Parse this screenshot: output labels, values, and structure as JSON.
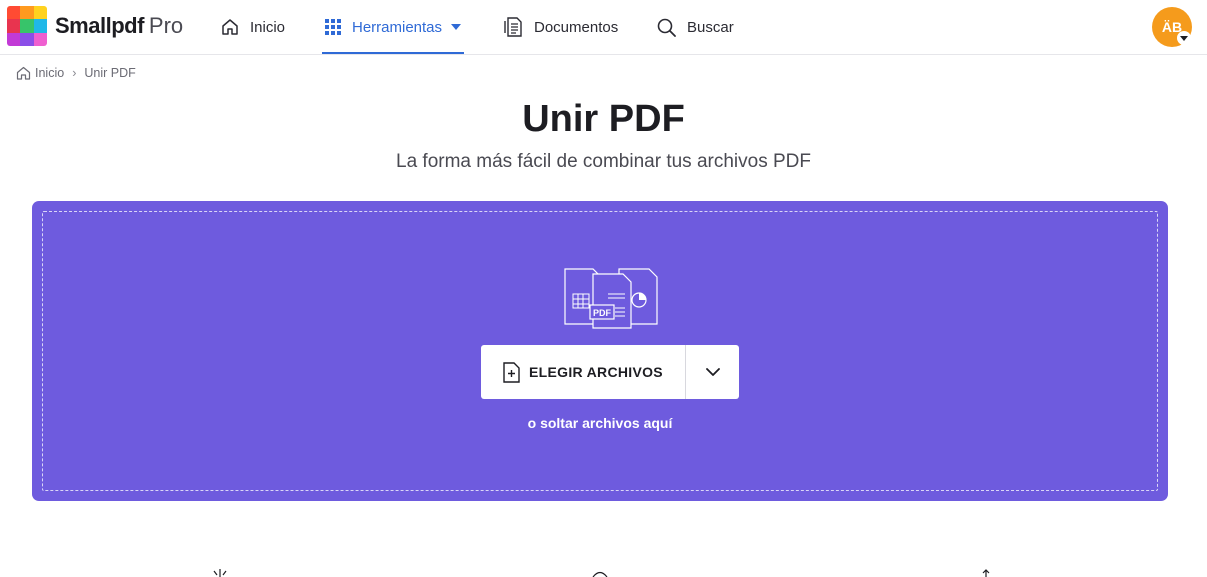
{
  "header": {
    "brand": "Smallpdf",
    "brand_tier": "Pro",
    "nav": [
      {
        "label": "Inicio",
        "icon": "home-icon"
      },
      {
        "label": "Herramientas",
        "icon": "grid-icon",
        "active": true
      },
      {
        "label": "Documentos",
        "icon": "documents-icon"
      },
      {
        "label": "Buscar",
        "icon": "search-icon"
      }
    ],
    "avatar_initials": "ÄB"
  },
  "breadcrumb": {
    "home": "Inicio",
    "separator": "›",
    "current": "Unir PDF"
  },
  "page": {
    "title": "Unir PDF",
    "subtitle": "La forma más fácil de combinar tus archivos PDF"
  },
  "dropzone": {
    "illustration_badge": "PDF",
    "choose_label": "ELEGIR ARCHIVOS",
    "drop_hint": "o soltar archivos aquí"
  },
  "colors": {
    "accent": "#2f6ad6",
    "dropzone": "#6e5bde",
    "avatar": "#f59b1c"
  }
}
